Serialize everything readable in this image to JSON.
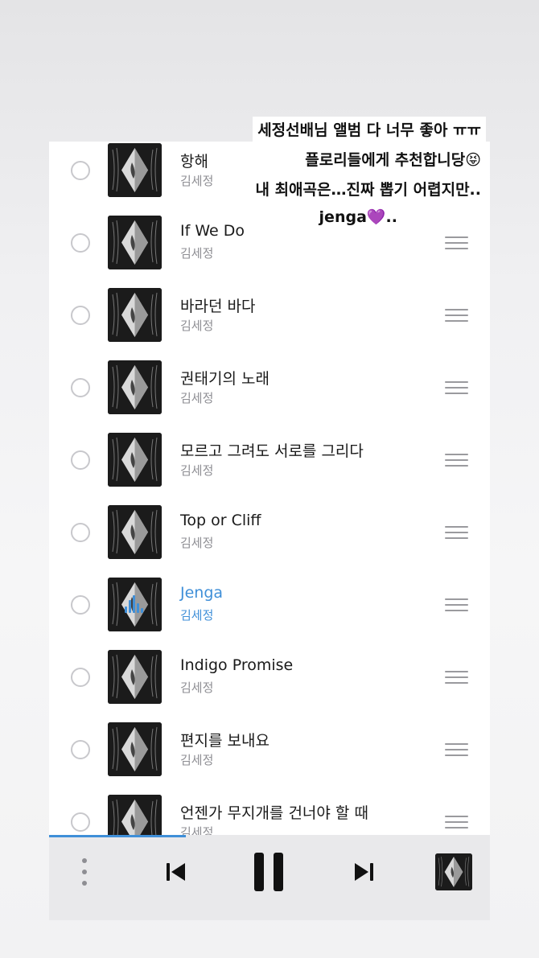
{
  "overlay_text": [
    "세정선배님 앨범 다 너무 좋아 ㅠㅠ",
    "플로리들에게 추천합니당😝",
    "내 최애곡은…진짜 뽑기 어렵지만..",
    "jenga💜.."
  ],
  "playlist": [
    {
      "title": "항해",
      "artist": "김세정",
      "playing": false
    },
    {
      "title": "If We Do",
      "artist": "김세정",
      "playing": false
    },
    {
      "title": "바라던 바다",
      "artist": "김세정",
      "playing": false
    },
    {
      "title": "권태기의 노래",
      "artist": "김세정",
      "playing": false
    },
    {
      "title": "모르고 그려도 서로를 그리다",
      "artist": "김세정",
      "playing": false
    },
    {
      "title": "Top or Cliff",
      "artist": "김세정",
      "playing": false
    },
    {
      "title": "Jenga",
      "artist": "김세정",
      "playing": true
    },
    {
      "title": "Indigo Promise",
      "artist": "김세정",
      "playing": false
    },
    {
      "title": "편지를 보내요",
      "artist": "김세정",
      "playing": false
    },
    {
      "title": "언젠가 무지개를 건너야 할 때",
      "artist": "김세정",
      "playing": false
    }
  ],
  "player": {
    "progress": 0.31,
    "icons": [
      "more-vertical-icon",
      "previous-track-icon",
      "pause-icon",
      "next-track-icon"
    ]
  },
  "colors": {
    "accent": "#3f8fd8",
    "text": "#1a1a1a",
    "subtext": "#8e8e93",
    "album_bg": "#1b1b1b"
  }
}
